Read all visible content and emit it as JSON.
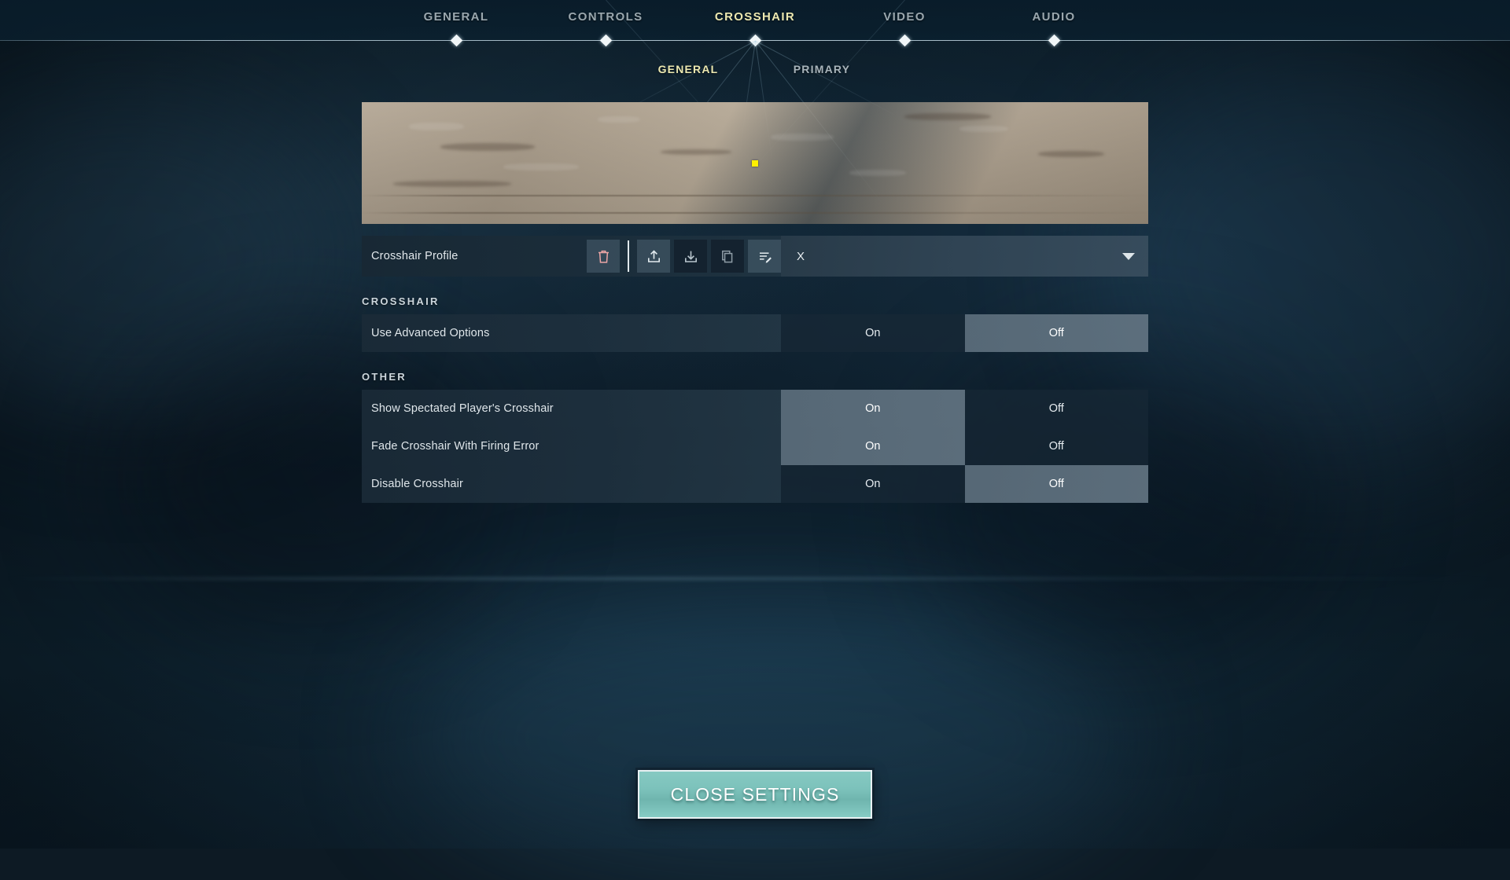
{
  "nav": {
    "tabs": [
      {
        "label": "GENERAL",
        "active": false
      },
      {
        "label": "CONTROLS",
        "active": false
      },
      {
        "label": "CROSSHAIR",
        "active": true
      },
      {
        "label": "VIDEO",
        "active": false
      },
      {
        "label": "AUDIO",
        "active": false
      }
    ]
  },
  "subnav": {
    "tabs": [
      {
        "label": "GENERAL",
        "active": true
      },
      {
        "label": "PRIMARY",
        "active": false
      }
    ]
  },
  "preview": {
    "crosshair_color": "#ffef00",
    "wall_color": "#ab9e8c"
  },
  "profile": {
    "label": "Crosshair Profile",
    "selected": "X",
    "icons": [
      {
        "name": "delete-icon",
        "style": "lite"
      },
      {
        "name": "divider",
        "style": "divider"
      },
      {
        "name": "upload-icon",
        "style": "lite"
      },
      {
        "name": "download-icon",
        "style": "dark"
      },
      {
        "name": "copy-icon",
        "style": "dark"
      },
      {
        "name": "rename-icon",
        "style": "lite"
      }
    ],
    "delete_color": "#eda6a6"
  },
  "sections": [
    {
      "title": "CROSSHAIR",
      "rows": [
        {
          "label": "Use Advanced Options",
          "options": [
            {
              "label": "On",
              "selected": false
            },
            {
              "label": "Off",
              "selected": true
            }
          ]
        }
      ]
    },
    {
      "title": "OTHER",
      "rows": [
        {
          "label": "Show Spectated Player's Crosshair",
          "options": [
            {
              "label": "On",
              "selected": true
            },
            {
              "label": "Off",
              "selected": false
            }
          ]
        },
        {
          "label": "Fade Crosshair With Firing Error",
          "options": [
            {
              "label": "On",
              "selected": true
            },
            {
              "label": "Off",
              "selected": false
            }
          ]
        },
        {
          "label": "Disable Crosshair",
          "options": [
            {
              "label": "On",
              "selected": false
            },
            {
              "label": "Off",
              "selected": true
            }
          ]
        }
      ]
    }
  ],
  "footer": {
    "close_label": "CLOSE SETTINGS",
    "accent": "#7cc2bb"
  }
}
